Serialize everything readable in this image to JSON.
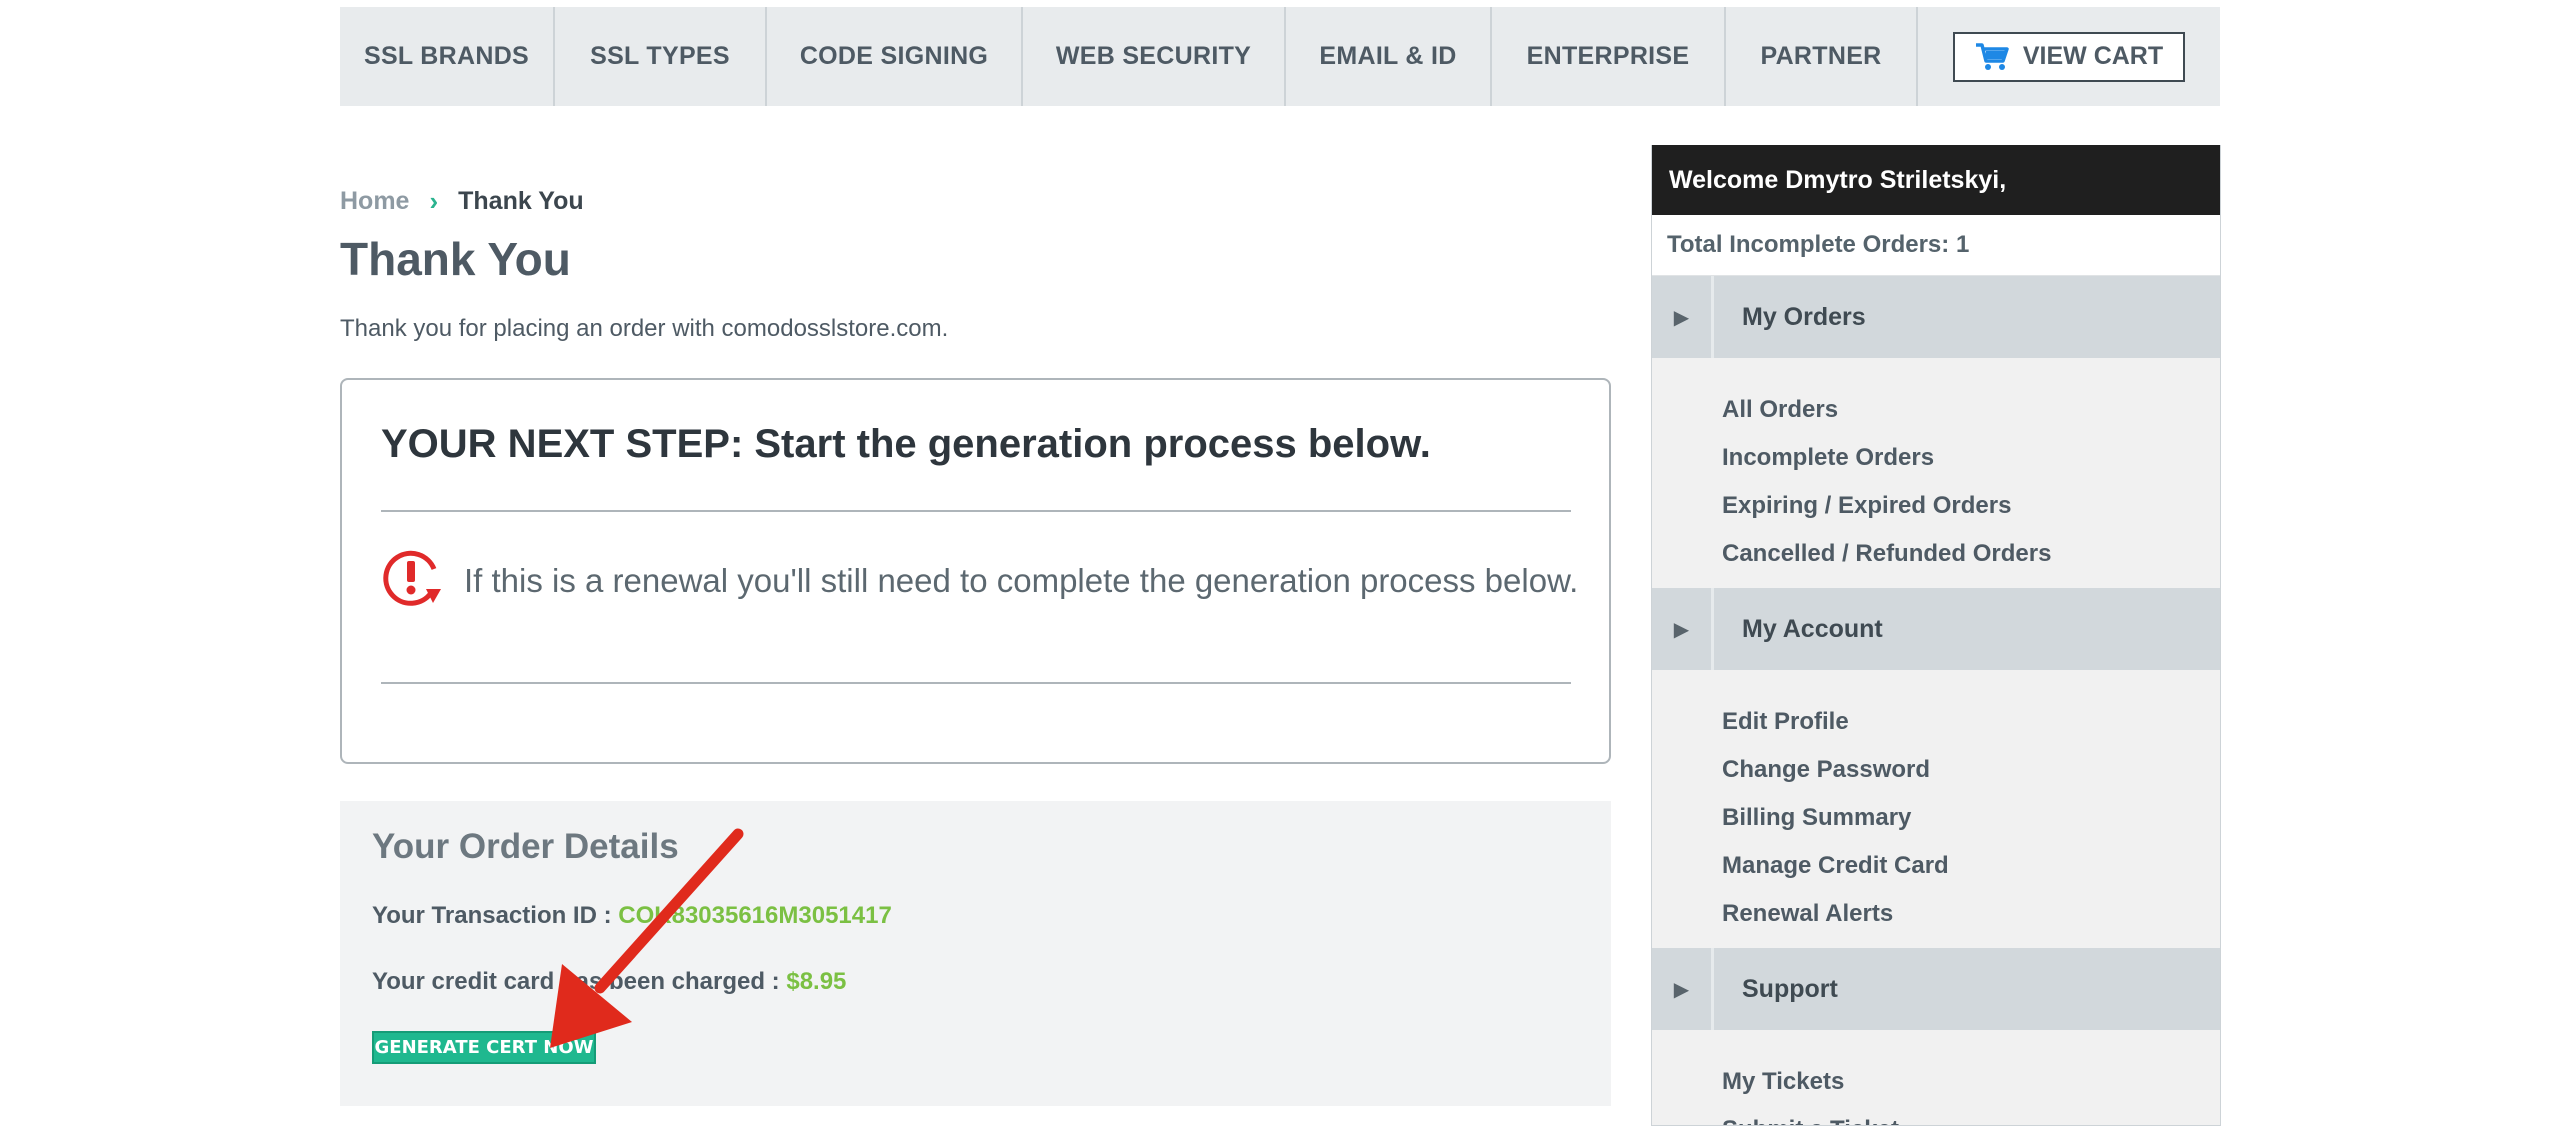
{
  "nav": {
    "items": [
      "SSL BRANDS",
      "SSL TYPES",
      "CODE SIGNING",
      "WEB SECURITY",
      "EMAIL & ID",
      "ENTERPRISE",
      "PARTNER"
    ],
    "cart_label": "VIEW CART",
    "cart_icon": "cart-icon"
  },
  "breadcrumb": {
    "home": "Home",
    "current": "Thank You"
  },
  "page": {
    "title": "Thank You",
    "intro": "Thank you for placing an order with comodosslstore.com."
  },
  "next_step": {
    "heading": "YOUR NEXT STEP: Start the generation process below.",
    "renewal_note": "If this is a renewal you'll still need to complete the generation process below.",
    "icon": "renewal-alert-icon"
  },
  "order": {
    "title": "Your Order Details",
    "transaction_label": "Your Transaction ID :",
    "transaction_id": "COK83035616M3051417",
    "charged_label": "Your credit card has been charged :",
    "charged_amount": "$8.95",
    "generate_button": "GENERATE CERT NOW"
  },
  "sidebar": {
    "welcome": "Welcome Dmytro Striletskyi,",
    "incomplete_orders": "Total Incomplete Orders: 1",
    "sections": [
      {
        "title": "My Orders",
        "items": [
          "All Orders",
          "Incomplete Orders",
          "Expiring / Expired Orders",
          "Cancelled / Refunded Orders"
        ]
      },
      {
        "title": "My Account",
        "items": [
          "Edit Profile",
          "Change Password",
          "Billing Summary",
          "Manage Credit Card",
          "Renewal Alerts"
        ]
      },
      {
        "title": "Support",
        "items": [
          "My Tickets",
          "Submit a Ticket"
        ]
      }
    ]
  },
  "colors": {
    "accent_green": "#1fb88f",
    "value_green": "#7bc043",
    "annotation_red": "#e02a1c"
  }
}
